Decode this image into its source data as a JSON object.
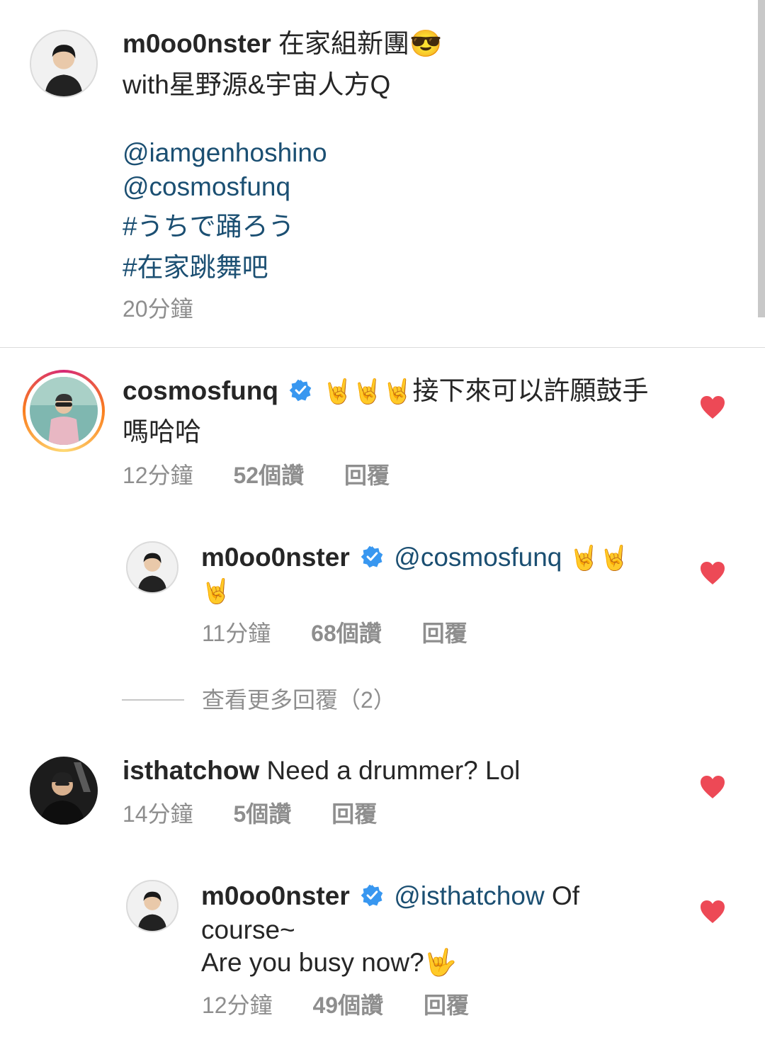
{
  "caption": {
    "username": "m0oo0nster",
    "text": "在家組新團😎",
    "line2": "with星野源&宇宙人方Q",
    "mentions": [
      "@iamgenhoshino",
      "@cosmosfunq"
    ],
    "hashtags": [
      "#うちで踊ろう",
      "#在家跳舞吧"
    ],
    "time": "20分鐘"
  },
  "comments": [
    {
      "username": "cosmosfunq",
      "verified": true,
      "emoji": "🤘🤘🤘",
      "text_a": "接下來可以許願鼓手",
      "text_b": "嗎哈哈",
      "time": "12分鐘",
      "likes": "52個讚",
      "reply": "回覆"
    },
    {
      "username": "m0oo0nster",
      "verified": true,
      "mention": "@cosmosfunq",
      "emoji_a": "🤘🤘",
      "emoji_b": "🤘",
      "time": "11分鐘",
      "likes": "68個讚",
      "reply": "回覆"
    },
    {
      "username": "isthatchow",
      "text": "Need a drummer? Lol",
      "time": "14分鐘",
      "likes": "5個讚",
      "reply": "回覆"
    },
    {
      "username": "m0oo0nster",
      "verified": true,
      "mention": "@isthatchow",
      "text_a": "Of",
      "text_b": "course~",
      "text_c": "Are you busy now?🤟",
      "time": "12分鐘",
      "likes": "49個讚",
      "reply": "回覆"
    }
  ],
  "view_more_replies": "查看更多回覆（2）",
  "colors": {
    "heart": "#ed4956",
    "verified": "#3897f0",
    "link": "#1b4f72",
    "meta": "#8e8e8e"
  }
}
